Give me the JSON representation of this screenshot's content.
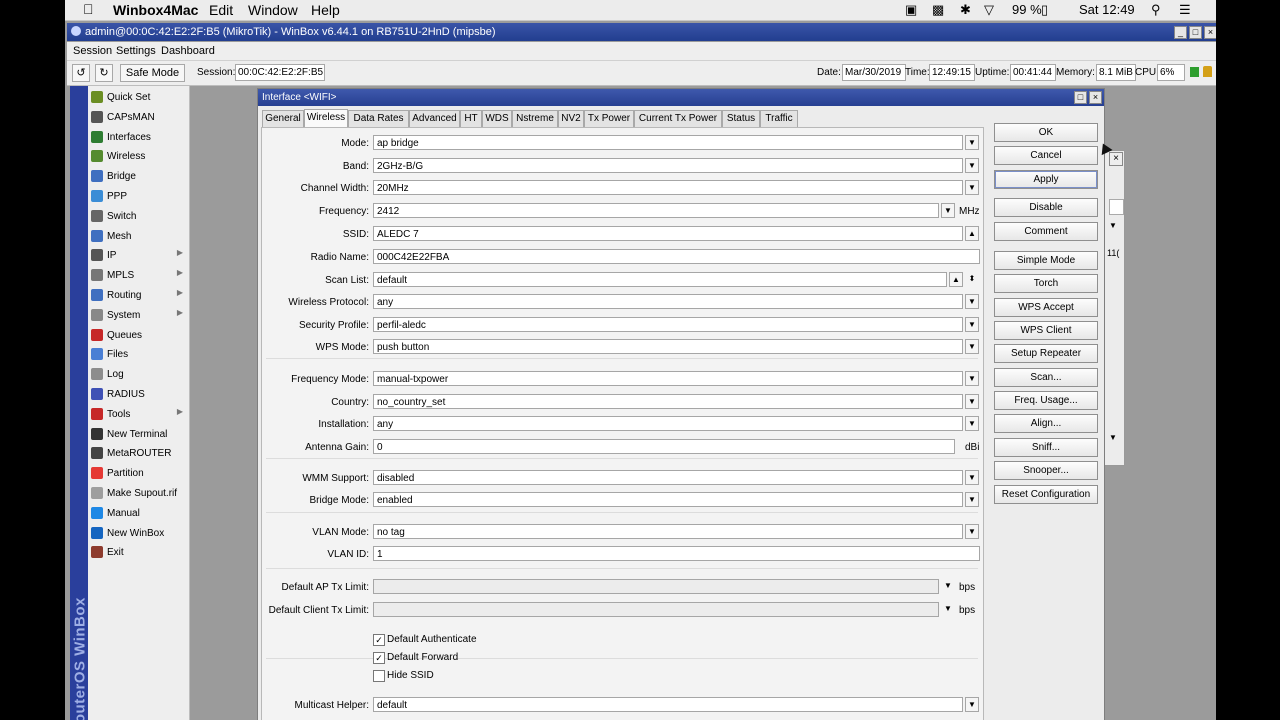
{
  "mac": {
    "app_name": "Winbox4Mac",
    "menus": [
      "Edit",
      "Window",
      "Help"
    ],
    "battery": "99 %",
    "clock": "Sat 12:49"
  },
  "window": {
    "title": "admin@00:0C:42:E2:2F:B5 (MikroTik) - WinBox v6.44.1 on RB751U-2HnD (mipsbe)"
  },
  "wmenu": [
    "Session",
    "Settings",
    "Dashboard"
  ],
  "toolbar": {
    "safe_mode": "Safe Mode",
    "session_label": "Session:",
    "session_value": "00:0C:42:E2:2F:B5",
    "date_label": "Date:",
    "date_value": "Mar/30/2019",
    "time_label": "Time:",
    "time_value": "12:49:15",
    "uptime_label": "Uptime:",
    "uptime_value": "00:41:44",
    "memory_label": "Memory:",
    "memory_value": "8.1 MiB",
    "cpu_label": "CPU:",
    "cpu_value": "6%"
  },
  "sidebar": {
    "brand": "RouterOS WinBox",
    "items": [
      {
        "label": "Quick Set",
        "icon": "quickset-icon",
        "color": "#6b8e23",
        "arrow": false
      },
      {
        "label": "CAPsMAN",
        "icon": "capsman-icon",
        "color": "#555555",
        "arrow": false
      },
      {
        "label": "Interfaces",
        "icon": "interfaces-icon",
        "color": "#2e7d32",
        "arrow": false
      },
      {
        "label": "Wireless",
        "icon": "wireless-icon",
        "color": "#558b2f",
        "arrow": false
      },
      {
        "label": "Bridge",
        "icon": "bridge-icon",
        "color": "#3f6fc0",
        "arrow": false
      },
      {
        "label": "PPP",
        "icon": "ppp-icon",
        "color": "#3b8dd6",
        "arrow": false
      },
      {
        "label": "Switch",
        "icon": "switch-icon",
        "color": "#666666",
        "arrow": false
      },
      {
        "label": "Mesh",
        "icon": "mesh-icon",
        "color": "#3f6fc0",
        "arrow": false
      },
      {
        "label": "IP",
        "icon": "ip-icon",
        "color": "#555555",
        "arrow": true
      },
      {
        "label": "MPLS",
        "icon": "mpls-icon",
        "color": "#777777",
        "arrow": true
      },
      {
        "label": "Routing",
        "icon": "routing-icon",
        "color": "#3f6fc0",
        "arrow": true
      },
      {
        "label": "System",
        "icon": "system-icon",
        "color": "#888888",
        "arrow": true
      },
      {
        "label": "Queues",
        "icon": "queues-icon",
        "color": "#c62828",
        "arrow": false
      },
      {
        "label": "Files",
        "icon": "files-icon",
        "color": "#4a7fd4",
        "arrow": false
      },
      {
        "label": "Log",
        "icon": "log-icon",
        "color": "#8d8d8d",
        "arrow": false
      },
      {
        "label": "RADIUS",
        "icon": "radius-icon",
        "color": "#3f51b5",
        "arrow": false
      },
      {
        "label": "Tools",
        "icon": "tools-icon",
        "color": "#c62828",
        "arrow": true
      },
      {
        "label": "New Terminal",
        "icon": "terminal-icon",
        "color": "#333333",
        "arrow": false
      },
      {
        "label": "MetaROUTER",
        "icon": "metarouter-icon",
        "color": "#444444",
        "arrow": false
      },
      {
        "label": "Partition",
        "icon": "partition-icon",
        "color": "#e53935",
        "arrow": false
      },
      {
        "label": "Make Supout.rif",
        "icon": "supout-icon",
        "color": "#9e9e9e",
        "arrow": false
      },
      {
        "label": "Manual",
        "icon": "manual-icon",
        "color": "#1e88e5",
        "arrow": false
      },
      {
        "label": "New WinBox",
        "icon": "winbox-icon",
        "color": "#1565c0",
        "arrow": false
      },
      {
        "label": "Exit",
        "icon": "exit-icon",
        "color": "#8d3b2d",
        "arrow": false
      }
    ]
  },
  "dialog": {
    "title": "Interface <WIFI>",
    "tabs": [
      "General",
      "Wireless",
      "Data Rates",
      "Advanced",
      "HT",
      "WDS",
      "Nstreme",
      "NV2",
      "Tx Power",
      "Current Tx Power",
      "Status",
      "Traffic"
    ],
    "active_tab": "Wireless",
    "fields": [
      {
        "label": "Mode:",
        "value": "ap bridge"
      },
      {
        "label": "Band:",
        "value": "2GHz-B/G"
      },
      {
        "label": "Channel Width:",
        "value": "20MHz"
      },
      {
        "label": "Frequency:",
        "value": "2412",
        "unit": "MHz"
      },
      {
        "label": "SSID:",
        "value": "ALEDC 7"
      },
      {
        "label": "Radio Name:",
        "value": "000C42E22FBA"
      },
      {
        "label": "Scan List:",
        "value": "default"
      },
      {
        "label": "Wireless Protocol:",
        "value": "any"
      },
      {
        "label": "Security Profile:",
        "value": "perfil-aledc"
      },
      {
        "label": "WPS Mode:",
        "value": "push button"
      },
      {
        "label": "Frequency Mode:",
        "value": "manual-txpower"
      },
      {
        "label": "Country:",
        "value": "no_country_set"
      },
      {
        "label": "Installation:",
        "value": "any"
      },
      {
        "label": "Antenna Gain:",
        "value": "0",
        "unit": "dBi"
      },
      {
        "label": "WMM Support:",
        "value": "disabled"
      },
      {
        "label": "Bridge Mode:",
        "value": "enabled"
      },
      {
        "label": "VLAN Mode:",
        "value": "no tag"
      },
      {
        "label": "VLAN ID:",
        "value": "1"
      },
      {
        "label": "Default AP Tx Limit:",
        "value": "",
        "unit": "bps"
      },
      {
        "label": "Default Client Tx Limit:",
        "value": "",
        "unit": "bps"
      },
      {
        "label": "Multicast Helper:",
        "value": "default"
      }
    ],
    "checks": [
      {
        "label": "Default Authenticate",
        "checked": true
      },
      {
        "label": "Default Forward",
        "checked": true
      },
      {
        "label": "Hide SSID",
        "checked": false
      }
    ],
    "buttons": [
      "OK",
      "Cancel",
      "Apply",
      "Disable",
      "Comment",
      "Simple Mode",
      "Torch",
      "WPS Accept",
      "WPS Client",
      "Setup Repeater",
      "Scan...",
      "Freq. Usage...",
      "Align...",
      "Sniff...",
      "Snooper...",
      "Reset Configuration"
    ]
  },
  "back_window": {
    "partial_text": "11("
  }
}
